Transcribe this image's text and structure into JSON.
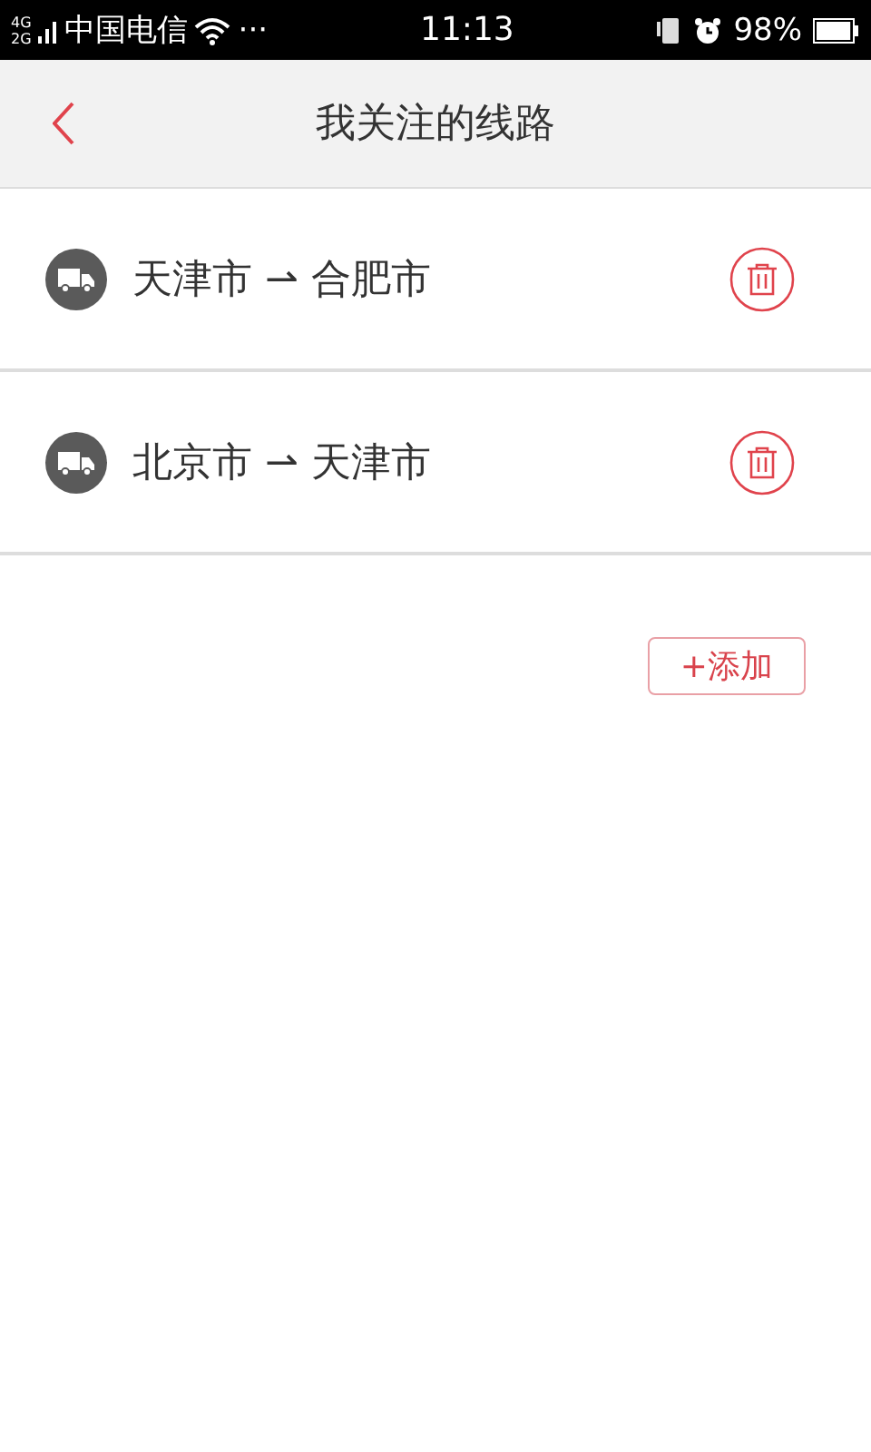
{
  "status_bar": {
    "network_top": "4G",
    "network_bottom": "2G",
    "carrier": "中国电信",
    "more": "···",
    "time": "11:13",
    "battery": "98%"
  },
  "header": {
    "title": "我关注的线路"
  },
  "routes": [
    {
      "text": "天津市 ⇀ 合肥市"
    },
    {
      "text": "北京市 ⇀ 天津市"
    }
  ],
  "add_button": "+添加"
}
